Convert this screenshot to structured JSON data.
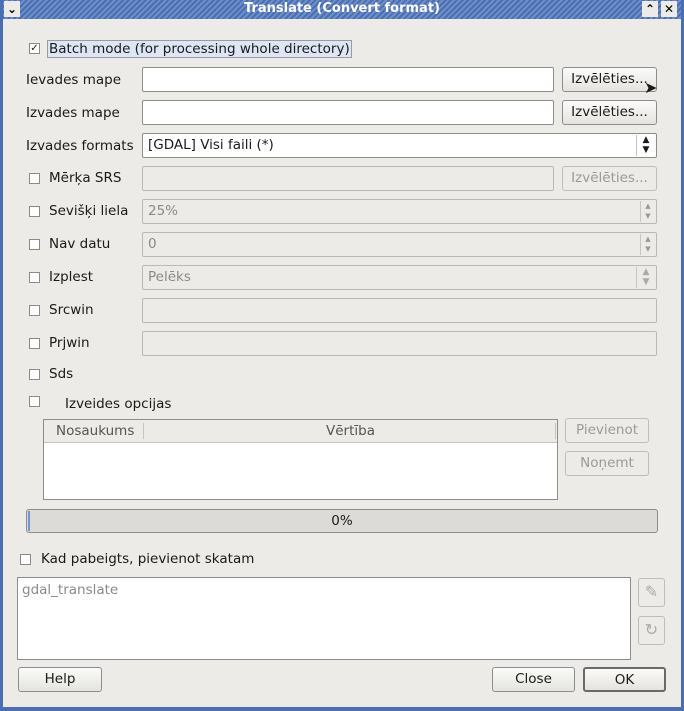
{
  "window": {
    "title": "Translate (Convert format)"
  },
  "batch": {
    "label": "Batch mode (for processing whole directory)",
    "checked": true
  },
  "input_dir": {
    "label": "Ievades mape",
    "value": "",
    "button": "Izvēlēties..."
  },
  "output_dir": {
    "label": "Izvades mape",
    "value": "",
    "button": "Izvēlēties..."
  },
  "output_format": {
    "label": "Izvades formats",
    "value": "[GDAL] Visi faili (*)"
  },
  "target_srs": {
    "label": "Mērķa SRS",
    "value": "",
    "button": "Izvēlēties..."
  },
  "outsize": {
    "label": "Sevišķi liela",
    "value": "25%"
  },
  "nodata": {
    "label": "Nav datu",
    "value": "0"
  },
  "expand": {
    "label": "Izplest",
    "value": "Pelēks"
  },
  "srcwin": {
    "label": "Srcwin",
    "value": ""
  },
  "prjwin": {
    "label": "Prjwin",
    "value": ""
  },
  "sds": {
    "label": "Sds"
  },
  "creation_options": {
    "label": "Izveides opcijas",
    "columns": [
      "Nosaukums",
      "Vērtība"
    ],
    "add_button": "Pievienot",
    "remove_button": "Noņemt"
  },
  "progress": {
    "text": "0%",
    "value": 0
  },
  "load_view": {
    "label": "Kad pabeigts, pievienot skatam"
  },
  "command": {
    "text": "gdal_translate"
  },
  "footer": {
    "help": "Help",
    "close": "Close",
    "ok": "OK"
  }
}
